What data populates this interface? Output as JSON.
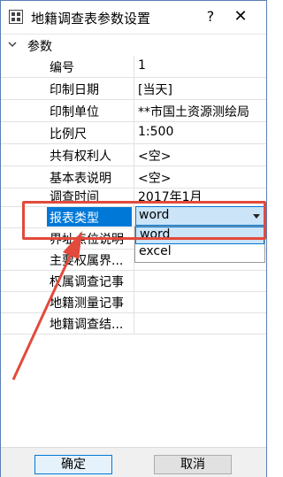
{
  "window": {
    "title": "地籍调查表参数设置",
    "help_label": "?",
    "close_label": "✕",
    "icon": "app-grid-icon"
  },
  "group": {
    "label": "参数",
    "expanded": true
  },
  "properties": [
    {
      "name": "编号",
      "value": "1"
    },
    {
      "name": "印制日期",
      "value": "[当天]"
    },
    {
      "name": "印制单位",
      "value": "**市国土资源测绘局"
    },
    {
      "name": "比例尺",
      "value": "1:500"
    },
    {
      "name": "共有权利人",
      "value": "<空>"
    },
    {
      "name": "基本表说明",
      "value": "<空>"
    },
    {
      "name": "调查时间",
      "value": "2017年1月"
    },
    {
      "name": "报表类型",
      "value": "word"
    },
    {
      "name": "界址点位说明",
      "value": ""
    },
    {
      "name": "主要权属界...",
      "value": ""
    },
    {
      "name": "权属调查记事",
      "value": ""
    },
    {
      "name": "地籍测量记事",
      "value": ""
    },
    {
      "name": "地籍调查结...",
      "value": ""
    }
  ],
  "selected_property": "报表类型",
  "report_type_combo": {
    "value": "word",
    "options": [
      "word",
      "excel"
    ],
    "highlighted_option": "word"
  },
  "annotation": {
    "color": "#e24a3b"
  },
  "buttons": {
    "ok_label": "确定",
    "cancel_label": "取消"
  },
  "colors": {
    "selection": "#0078d7",
    "combo_fill": "#cce4f7",
    "title_border": "#5a7fb5"
  }
}
